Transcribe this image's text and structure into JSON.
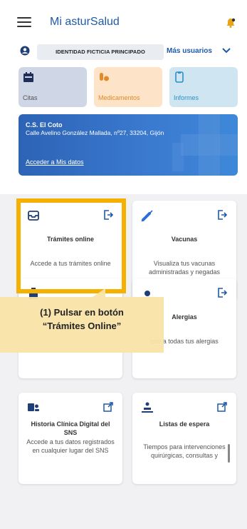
{
  "header": {
    "title": "Mi asturSalud",
    "menu_icon": "hamburger-icon",
    "notification_icon": "bell-icon"
  },
  "user": {
    "identity": "IDENTIDAD FICTICIA PRINCIPADO",
    "more_users_label": "Más usuarios"
  },
  "quick_tiles": [
    {
      "label": "Citas",
      "icon": "calendar-icon",
      "color": "#cfd6e6"
    },
    {
      "label": "Medicamentos",
      "icon": "pills-icon",
      "color": "#fde4c8"
    },
    {
      "label": "Informes",
      "icon": "document-icon",
      "color": "#cfe6f2"
    }
  ],
  "health_center": {
    "name": "C.S. El Coto",
    "address": "Calle Avelino González Mallada, nº27, 33204, Gijón",
    "link": "Acceder a Mis datos"
  },
  "cards": [
    {
      "title": "Trámites online",
      "desc": "Accede a tus trámites online",
      "icon": "inbox-icon",
      "action": "open-external-icon"
    },
    {
      "title": "Vacunas",
      "desc": "Visualiza tus vacunas administradas y negadas",
      "icon": "syringe-icon",
      "action": "open-external-icon"
    },
    {
      "title": "",
      "desc": "",
      "icon": "clipboard-icon",
      "action": ""
    },
    {
      "title": "Alergias",
      "desc": "ede a todas tus alergias",
      "icon": "allergy-icon",
      "action": "open-external-icon"
    },
    {
      "title": "Historia Clínica Digital del SNS",
      "desc": "Accede a tus datos registrados en cualquier lugar del SNS",
      "icon": "medical-record-icon",
      "action": "external-link-icon"
    },
    {
      "title": "Listas de espera",
      "desc": "Tiempos para intervenciones quirúrgicas, consultas y",
      "icon": "patient-bed-icon",
      "action": "external-link-icon"
    }
  ],
  "callout": {
    "line1": "(1) Pulsar en botón",
    "line2": "“Trámites Online”"
  },
  "colors": {
    "brand_blue": "#1f5aa8",
    "highlight": "#f6b100",
    "callout_bg": "#f9e4a8"
  }
}
